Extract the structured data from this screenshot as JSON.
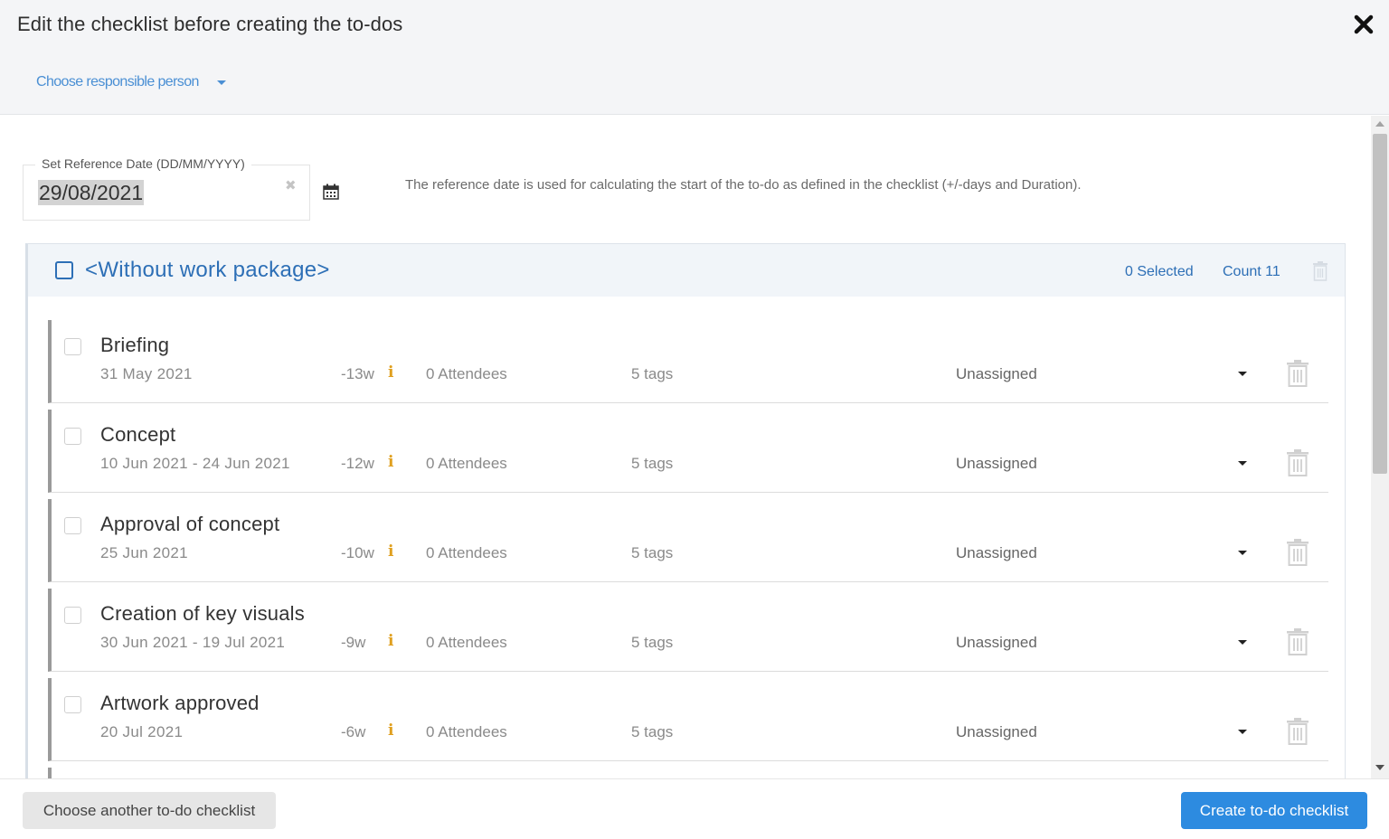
{
  "dialog": {
    "title": "Edit the checklist before creating the to-dos",
    "close_icon": "close-icon",
    "responsible_label": "Choose responsible person"
  },
  "reference": {
    "legend": "Set Reference Date (DD/MM/YYYY)",
    "value": "29/08/2021",
    "clear_glyph": "✖",
    "note": "The reference date is used for calculating the start of the to-do as defined in the checklist (+/-days and Duration)."
  },
  "group": {
    "title": "<Without work package>",
    "selected": "0 Selected",
    "count": "Count 11",
    "accent_color": "#2d6fb6"
  },
  "tasks": [
    {
      "name": "Briefing",
      "date": "31 May 2021",
      "offset": "-13w",
      "info": "i",
      "attendees": "0 Attendees",
      "tags": "5 tags",
      "assignee": "Unassigned"
    },
    {
      "name": "Concept",
      "date": "10 Jun 2021 - 24 Jun 2021",
      "offset": "-12w",
      "info": "i",
      "attendees": "0 Attendees",
      "tags": "5 tags",
      "assignee": "Unassigned"
    },
    {
      "name": "Approval of concept",
      "date": "25 Jun 2021",
      "offset": "-10w",
      "info": "i",
      "attendees": "0 Attendees",
      "tags": "5 tags",
      "assignee": "Unassigned"
    },
    {
      "name": "Creation of key visuals",
      "date": "30 Jun 2021 - 19 Jul 2021",
      "offset": "-9w",
      "info": "i",
      "attendees": "0 Attendees",
      "tags": "5 tags",
      "assignee": "Unassigned"
    },
    {
      "name": "Artwork approved",
      "date": "20 Jul 2021",
      "offset": "-6w",
      "info": "i",
      "attendees": "0 Attendees",
      "tags": "5 tags",
      "assignee": "Unassigned"
    }
  ],
  "footer": {
    "another_label": "Choose another to-do checklist",
    "create_label": "Create to-do checklist",
    "create_color": "#2d8be0"
  }
}
